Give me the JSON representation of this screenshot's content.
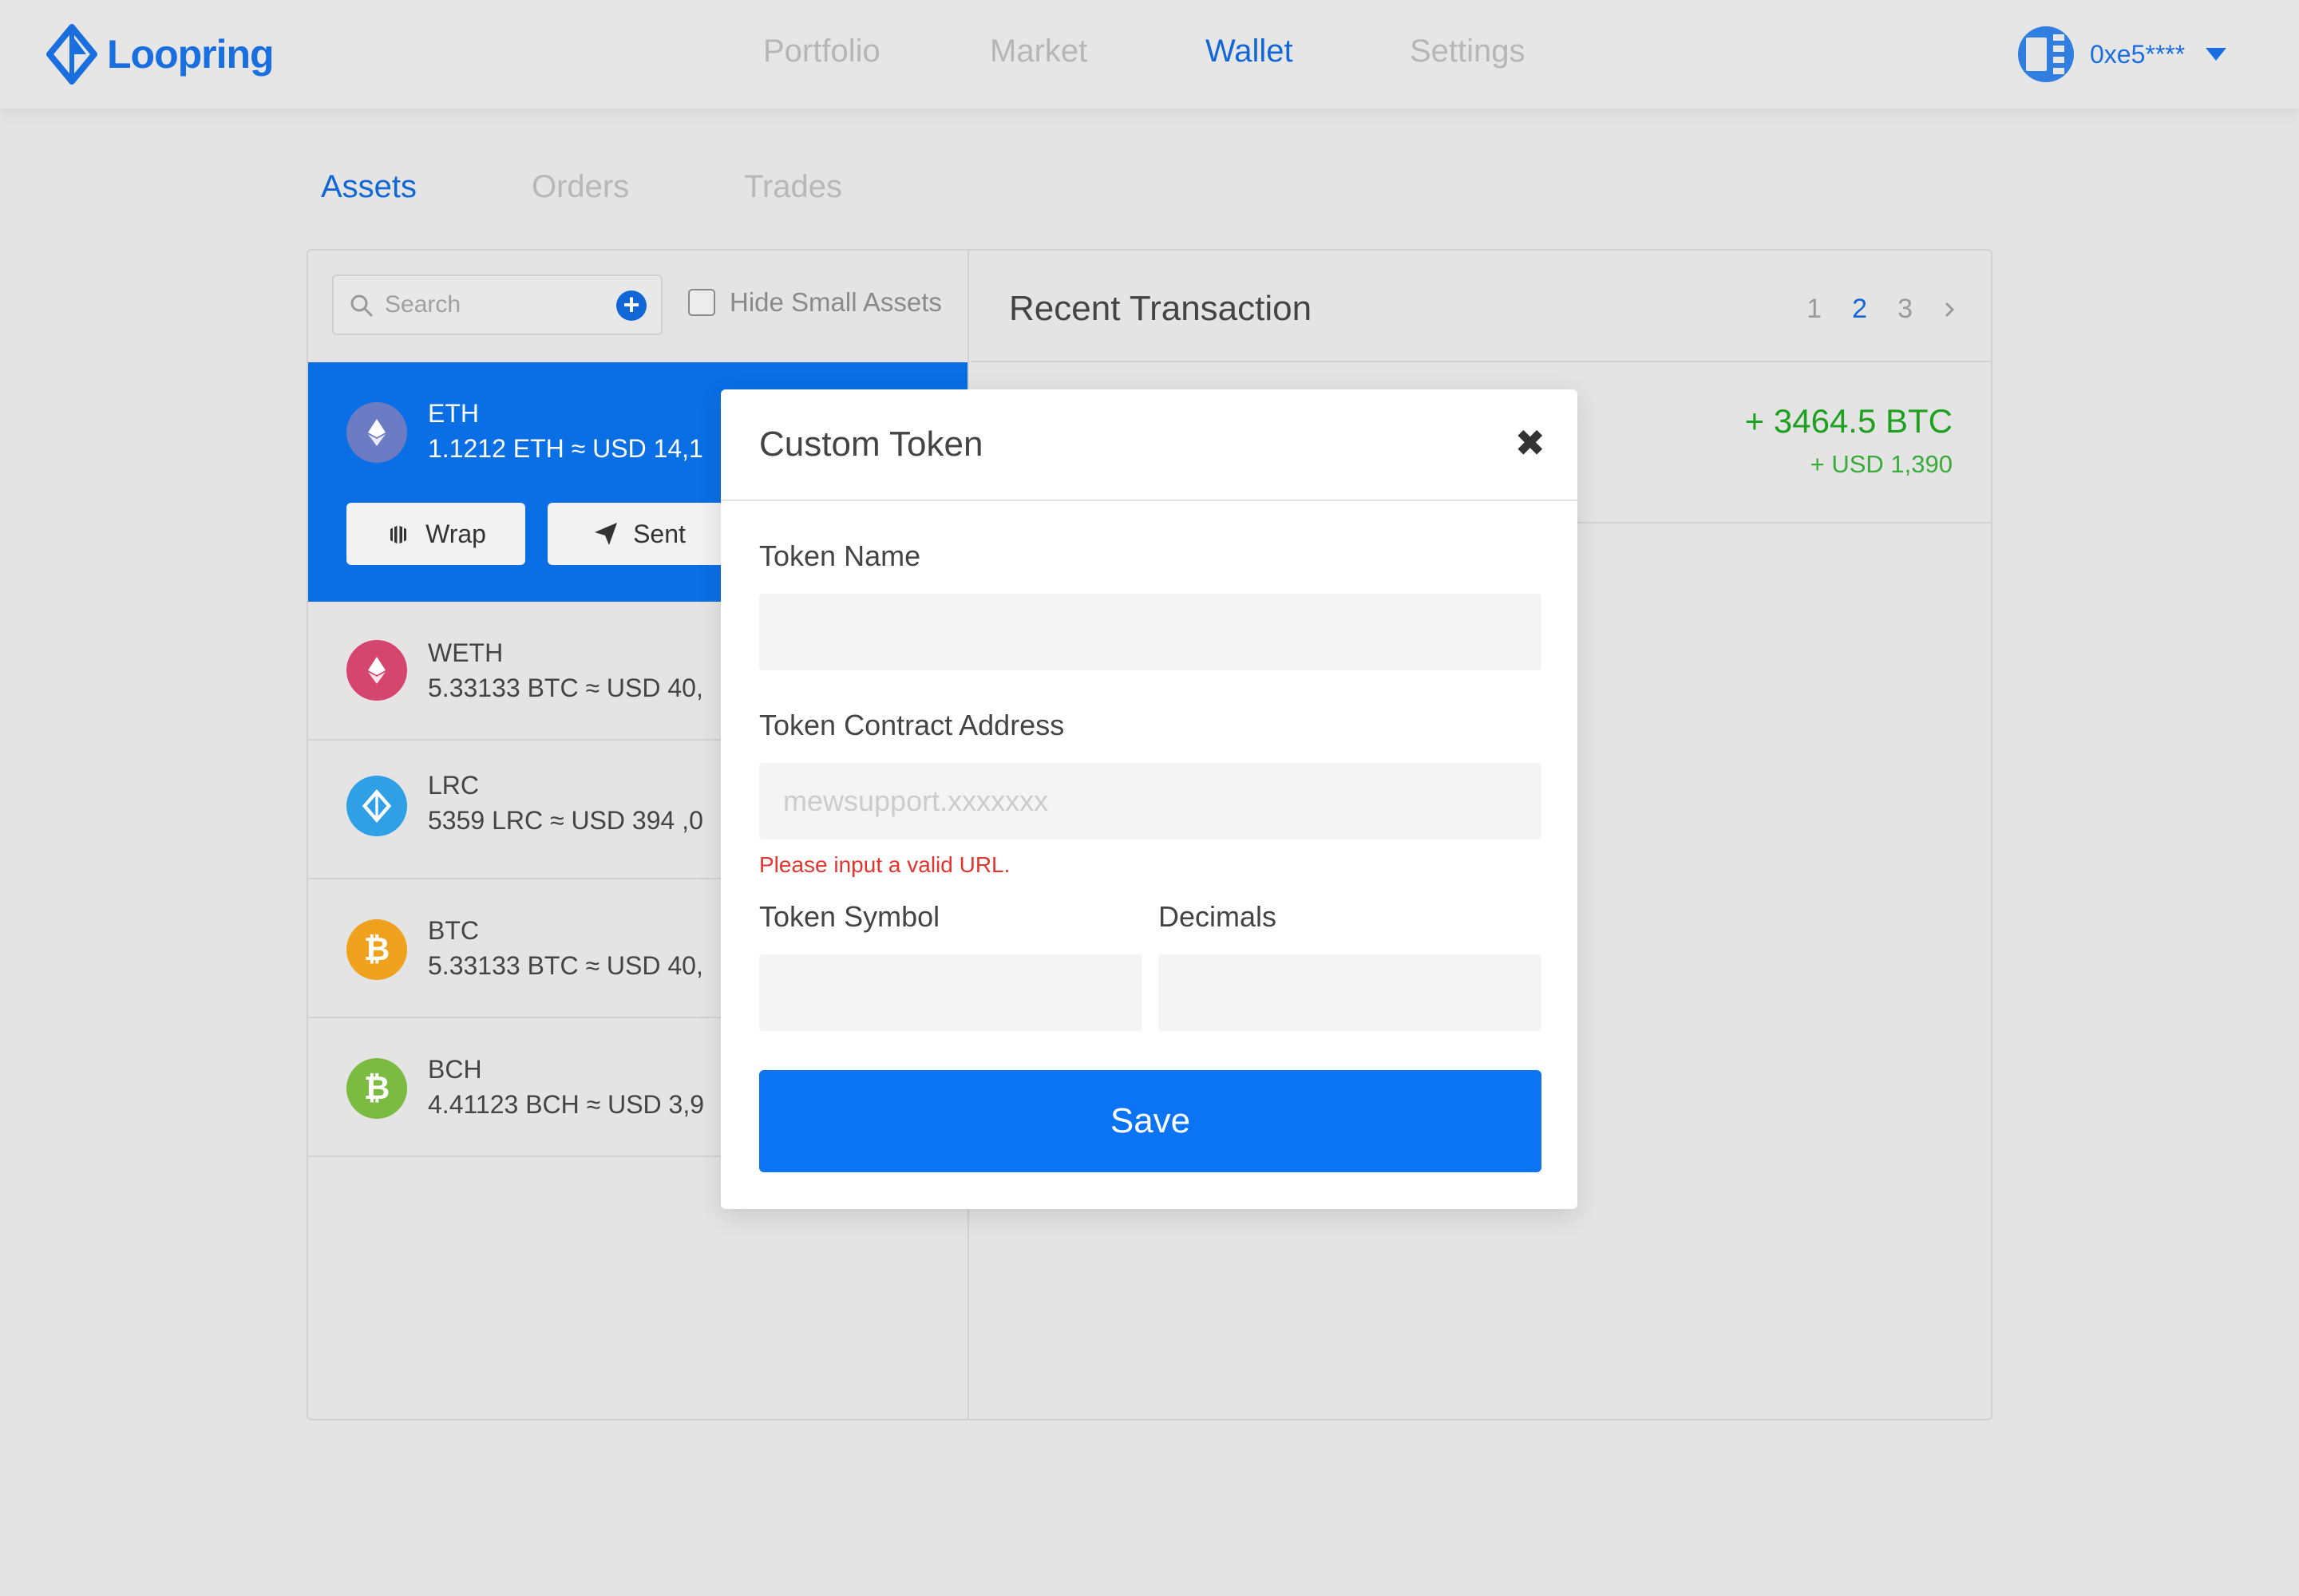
{
  "header": {
    "brand": "Loopring",
    "nav": [
      "Portfolio",
      "Market",
      "Wallet",
      "Settings"
    ],
    "active_nav": "Wallet",
    "account": "0xe5****"
  },
  "subtabs": [
    "Assets",
    "Orders",
    "Trades"
  ],
  "active_subtab": "Assets",
  "assets_panel": {
    "search_placeholder": "Search",
    "hide_small_label": "Hide Small Assets",
    "hide_small_checked": false,
    "items": [
      {
        "symbol": "ETH",
        "amount": "1.1212 ETH ≈ USD 14,1",
        "icon": "ethereum-icon",
        "color": "#6b7bc4",
        "selected": true
      },
      {
        "symbol": "WETH",
        "amount": "5.33133 BTC ≈ USD 40,",
        "icon": "ethereum-icon",
        "color": "#d4466e",
        "selected": false
      },
      {
        "symbol": "LRC",
        "amount": "5359 LRC ≈ USD 394 ,0",
        "icon": "loopring-icon",
        "color": "#2fa0e6",
        "selected": false
      },
      {
        "symbol": "BTC",
        "amount": "5.33133 BTC ≈ USD 40,",
        "icon": "bitcoin-icon",
        "color": "#f0a11e",
        "selected": false
      },
      {
        "symbol": "BCH",
        "amount": "4.41123 BCH ≈ USD 3,9",
        "icon": "bitcoin-cash-icon",
        "color": "#7cbb42",
        "selected": false
      }
    ],
    "wrap_label": "Wrap",
    "sent_label": "Sent"
  },
  "transactions": {
    "title": "Recent Transaction",
    "pages": [
      "1",
      "2",
      "3"
    ],
    "current_page": "2",
    "first": {
      "amount": "+ 3464.5 BTC",
      "usd": "+ USD 1,390"
    }
  },
  "modal": {
    "title": "Custom Token",
    "close": "✖",
    "token_name_label": "Token Name",
    "token_name_value": "",
    "contract_label": "Token Contract Address",
    "contract_placeholder": "mewsupport.xxxxxxx",
    "contract_error": "Please input a valid URL.",
    "symbol_label": "Token Symbol",
    "symbol_value": "",
    "decimals_label": "Decimals",
    "decimals_value": "",
    "save_label": "Save"
  },
  "colors": {
    "accent": "#1167d6",
    "selected_row": "#0a6fe5",
    "save_button": "#0a74f5",
    "positive": "#20a020",
    "error": "#e3342f"
  }
}
